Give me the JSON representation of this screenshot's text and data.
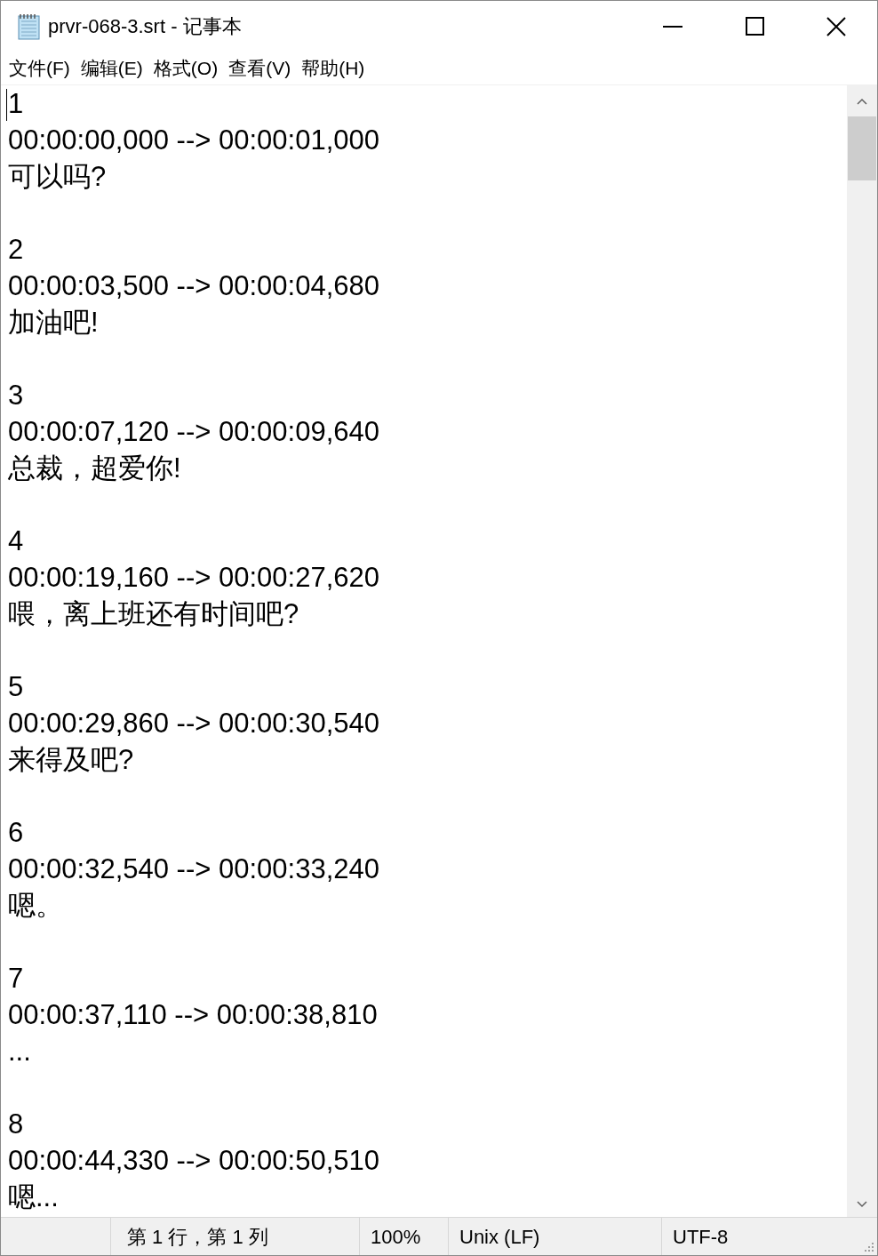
{
  "window": {
    "title": "prvr-068-3.srt - 记事本"
  },
  "menu": [
    "文件(F)",
    "编辑(E)",
    "格式(O)",
    "查看(V)",
    "帮助(H)"
  ],
  "subtitles": [
    {
      "number": "1",
      "timing": "00:00:00,000 --> 00:00:01,000",
      "text": "可以吗?"
    },
    {
      "number": "2",
      "timing": "00:00:03,500 --> 00:00:04,680",
      "text": "加油吧!"
    },
    {
      "number": "3",
      "timing": "00:00:07,120 --> 00:00:09,640",
      "text": "总裁，超爱你!"
    },
    {
      "number": "4",
      "timing": "00:00:19,160 --> 00:00:27,620",
      "text": "喂，离上班还有时间吧?"
    },
    {
      "number": "5",
      "timing": "00:00:29,860 --> 00:00:30,540",
      "text": "来得及吧?"
    },
    {
      "number": "6",
      "timing": "00:00:32,540 --> 00:00:33,240",
      "text": "嗯。"
    },
    {
      "number": "7",
      "timing": "00:00:37,110 --> 00:00:38,810",
      "text": "..."
    },
    {
      "number": "8",
      "timing": "00:00:44,330 --> 00:00:50,510",
      "text": "嗯..."
    }
  ],
  "status_bar": {
    "position": "第 1 行，第 1 列",
    "zoom": "100%",
    "line_ending": "Unix (LF)",
    "encoding": "UTF-8"
  }
}
